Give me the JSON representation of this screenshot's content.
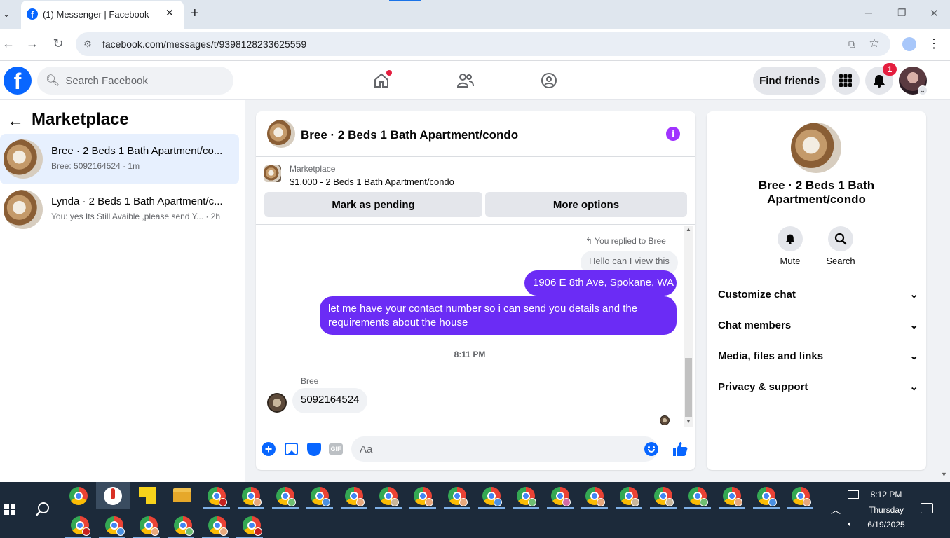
{
  "browser": {
    "tab_title": "(1) Messenger | Facebook",
    "new_tab": "+",
    "url": "facebook.com/messages/t/9398128233625559",
    "window_controls": {
      "minimize": "─",
      "restore": "❐",
      "close": "✕"
    }
  },
  "fb": {
    "search_placeholder": "Search Facebook",
    "find_friends": "Find friends",
    "notification_count": "1"
  },
  "left": {
    "title": "Marketplace",
    "conversations": [
      {
        "name": "Bree · 2 Beds 1 Bath Apartment/co...",
        "preview": "Bree: 5092164524 · 1m",
        "selected": true
      },
      {
        "name": "Lynda · 2 Beds 1 Bath Apartment/c...",
        "preview": "You: yes Its Still Avaible ,please send Y...",
        "time": "· 2h",
        "selected": false
      }
    ]
  },
  "chat": {
    "header_title": "Bree · 2 Beds 1 Bath Apartment/condo",
    "listing_label": "Marketplace",
    "listing_detail": "$1,000 - 2 Beds 1 Bath Apartment/condo",
    "mark_pending": "Mark as pending",
    "more_options": "More options",
    "replied_to": "You replied to Bree",
    "quoted": "Hello can I view this",
    "msg_address": "1906 E 8th Ave, Spokane, WA",
    "msg_contact": "let me have your contact number so i can send you details and the requirements about the house",
    "timestamp": "8:11 PM",
    "sender": "Bree",
    "incoming": "5092164524",
    "input_placeholder": "Aa",
    "gif": "GIF"
  },
  "right": {
    "name": "Bree · 2 Beds 1 Bath Apartment/condo",
    "mute": "Mute",
    "search": "Search",
    "menu": [
      "Customize chat",
      "Chat members",
      "Media, files and links",
      "Privacy & support"
    ]
  },
  "taskbar": {
    "time": "8:12 PM",
    "day": "Thursday",
    "date": "6/19/2025"
  },
  "colors": {
    "fb_blue": "#0866ff",
    "messenger_purple": "#6b2cf5",
    "selected_bg": "#e7f0fe"
  }
}
